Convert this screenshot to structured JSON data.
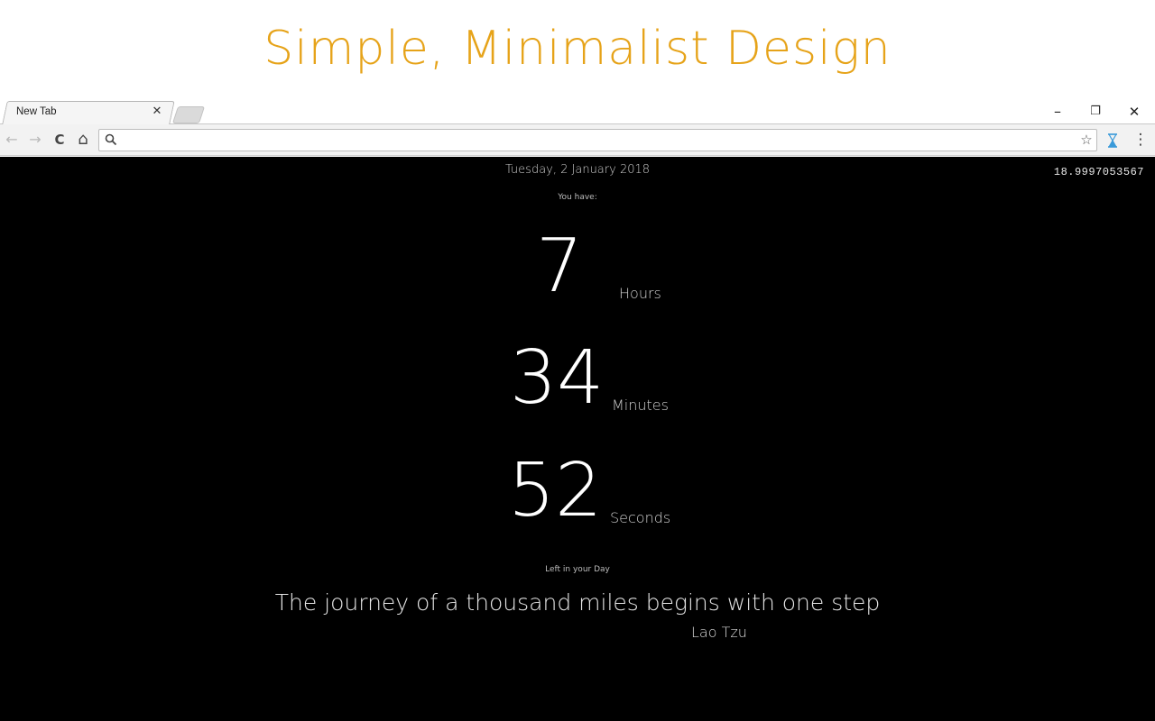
{
  "headline": "Simple, Minimalist Design",
  "browser": {
    "tab_title": "New Tab",
    "tab_close": "✕",
    "minimize": "–",
    "restore": "❐",
    "close": "✕",
    "back": "←",
    "forward": "→",
    "reload": "C",
    "home": "⌂",
    "omnibox_value": "",
    "star": "☆",
    "menu": "⋮"
  },
  "page": {
    "date": "Tuesday, 2 January 2018",
    "metric": "18.9997053567",
    "you_have": "You have:",
    "hours_value": "7",
    "hours_label": "Hours",
    "minutes_value": "34",
    "minutes_label": "Minutes",
    "seconds_value": "52",
    "seconds_label": "Seconds",
    "left_label": "Left in your Day",
    "quote": "The journey of a thousand miles begins with one step",
    "author": "Lao Tzu"
  },
  "colors": {
    "accent": "#e6a319",
    "page_bg": "#000000",
    "extension_icon": "#3a9ad9"
  }
}
